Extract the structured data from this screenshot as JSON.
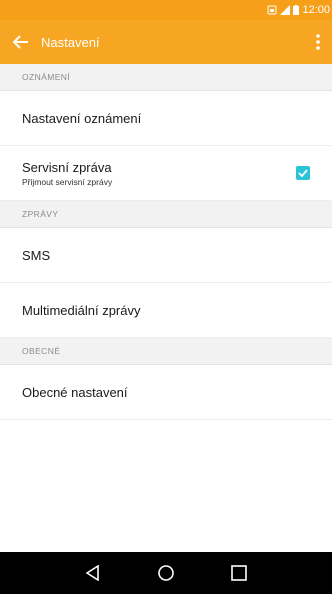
{
  "status_bar": {
    "time": "12:00",
    "icons": [
      "sim-icon",
      "signal-icon",
      "battery-icon"
    ]
  },
  "toolbar": {
    "title": "Nastavení",
    "back_icon": "arrow-left-icon",
    "more_icon": "more-vertical-icon"
  },
  "sections": [
    {
      "header": "OZNÁMENÍ",
      "items": [
        {
          "label": "Nastavení oznámení"
        },
        {
          "label": "Servisní zpráva",
          "sublabel": "Přijmout servisní zprávy",
          "checked": true
        }
      ]
    },
    {
      "header": "ZPRÁVY",
      "items": [
        {
          "label": "SMS"
        },
        {
          "label": "Multimediální zprávy"
        }
      ]
    },
    {
      "header": "OBECNÉ",
      "items": [
        {
          "label": "Obecné nastavení"
        }
      ]
    }
  ],
  "nav_bar": {
    "icons": [
      "back-triangle-icon",
      "home-circle-icon",
      "recents-square-icon"
    ]
  },
  "colors": {
    "accent": "#f7a623",
    "status_bar": "#f6a01a",
    "checkbox": "#2bc3d9",
    "section_bg": "#f2f2f2"
  }
}
